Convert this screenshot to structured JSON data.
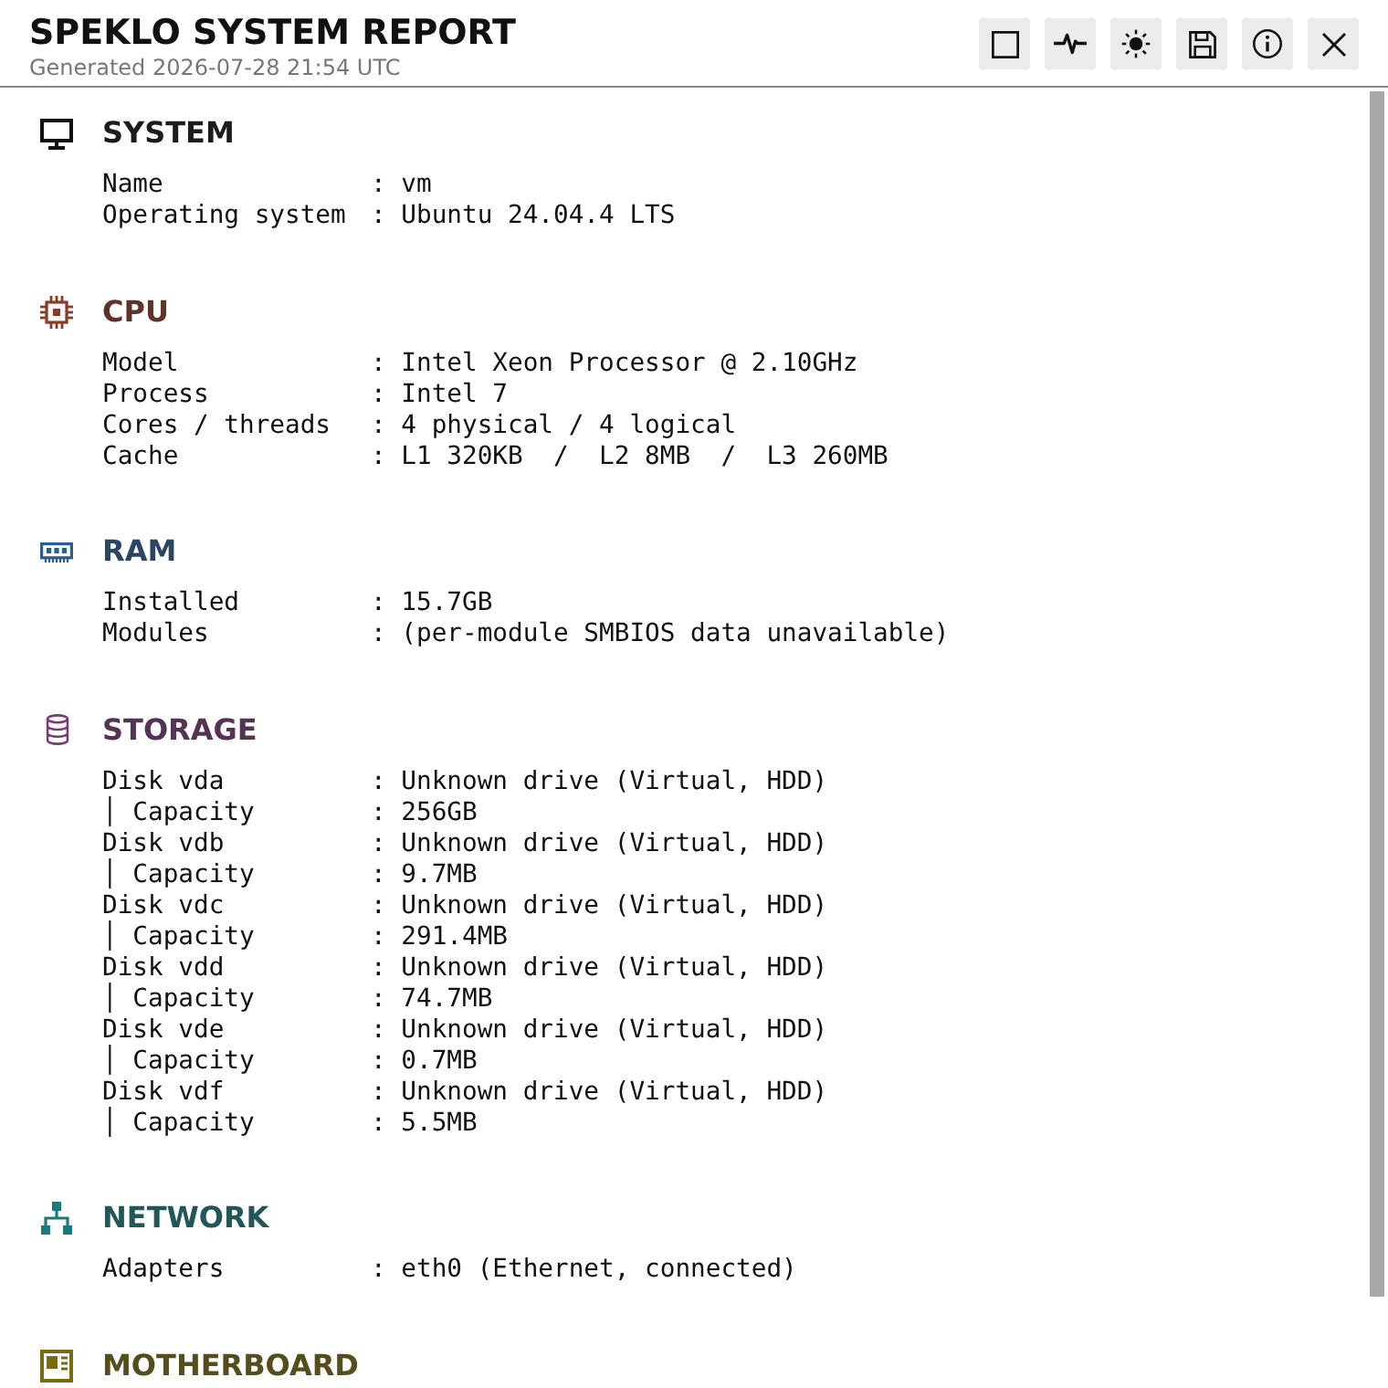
{
  "header": {
    "title": "SPEKLO SYSTEM REPORT",
    "subtitle": "Generated 2026-07-28 21:54 UTC",
    "buttons": [
      {
        "kind": "window"
      },
      {
        "kind": "activity"
      },
      {
        "kind": "theme"
      },
      {
        "kind": "save"
      },
      {
        "kind": "info"
      },
      {
        "kind": "close"
      }
    ]
  },
  "sections": [
    {
      "kind": "system",
      "title": "SYSTEM",
      "color": "#111111",
      "rows": [
        {
          "label": "Name",
          "value": ": vm"
        },
        {
          "label": "Operating system",
          "value": ": Ubuntu 24.04.4 LTS"
        }
      ]
    },
    {
      "kind": "cpu",
      "title": "CPU",
      "color": "#8b3a2a",
      "rows": [
        {
          "label": "Model",
          "value": ": Intel Xeon Processor @ 2.10GHz"
        },
        {
          "label": "Process",
          "value": ": Intel 7"
        },
        {
          "label": "Cores / threads",
          "value": ": 4 physical / 4 logical"
        },
        {
          "label": "Cache",
          "value": ": L1 320KB  /  L2 8MB  /  L3 260MB"
        }
      ]
    },
    {
      "kind": "ram",
      "title": "RAM",
      "color": "#2b5d95",
      "rows": [
        {
          "label": "Installed",
          "value": ": 15.7GB"
        },
        {
          "label": "Modules",
          "value": ": (per-module SMBIOS data unavailable)"
        }
      ]
    },
    {
      "kind": "storage",
      "title": "STORAGE",
      "color": "#7a3a78",
      "rows": [
        {
          "label": "Disk vda",
          "value": ": Unknown drive (Virtual, HDD)"
        },
        {
          "label": "│ Capacity",
          "value": ": 256GB"
        },
        {
          "label": "Disk vdb",
          "value": ": Unknown drive (Virtual, HDD)"
        },
        {
          "label": "│ Capacity",
          "value": ": 9.7MB"
        },
        {
          "label": "Disk vdc",
          "value": ": Unknown drive (Virtual, HDD)"
        },
        {
          "label": "│ Capacity",
          "value": ": 291.4MB"
        },
        {
          "label": "Disk vdd",
          "value": ": Unknown drive (Virtual, HDD)"
        },
        {
          "label": "│ Capacity",
          "value": ": 74.7MB"
        },
        {
          "label": "Disk vde",
          "value": ": Unknown drive (Virtual, HDD)"
        },
        {
          "label": "│ Capacity",
          "value": ": 0.7MB"
        },
        {
          "label": "Disk vdf",
          "value": ": Unknown drive (Virtual, HDD)"
        },
        {
          "label": "│ Capacity",
          "value": ": 5.5MB"
        }
      ]
    },
    {
      "kind": "network",
      "title": "NETWORK",
      "color": "#197b80",
      "rows": [
        {
          "label": "Adapters",
          "value": ": eth0 (Ethernet, connected)"
        }
      ]
    },
    {
      "kind": "motherboard",
      "title": "MOTHERBOARD",
      "color": "#7a6a12"
    }
  ]
}
